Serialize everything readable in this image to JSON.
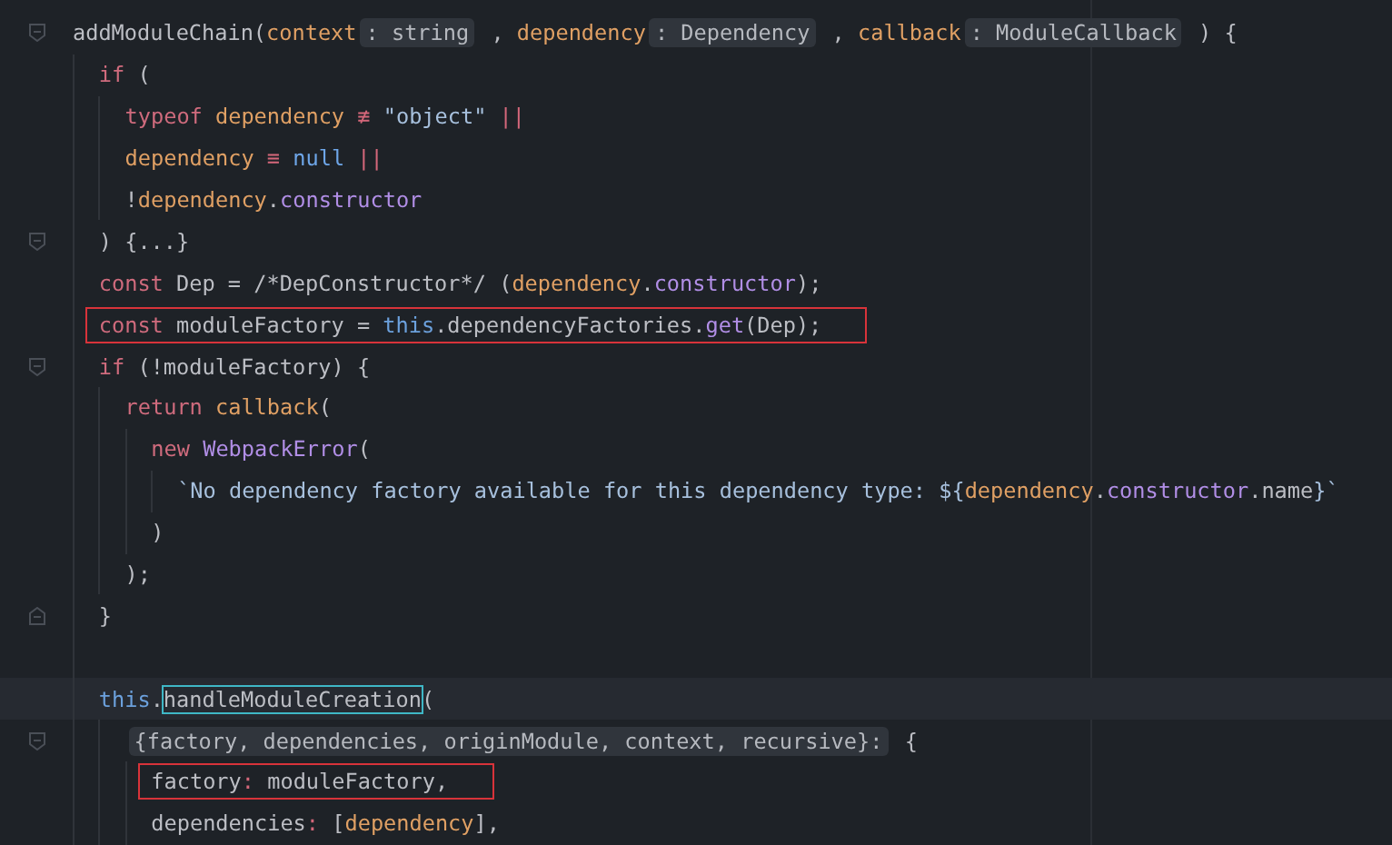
{
  "editor": {
    "lines": [
      {
        "kind": "code",
        "fold": {
          "kind": "start"
        },
        "tokens": [
          {
            "kind": "fn",
            "t": "addModuleChain("
          },
          {
            "kind": "param",
            "t": "context"
          },
          {
            "kind": "hint",
            "t": ": string"
          },
          {
            "kind": "plain",
            "t": " , "
          },
          {
            "kind": "param",
            "t": "dependency"
          },
          {
            "kind": "hint",
            "t": ": Dependency"
          },
          {
            "kind": "plain",
            "t": " , "
          },
          {
            "kind": "param",
            "t": "callback"
          },
          {
            "kind": "hint",
            "t": ": ModuleCallback"
          },
          {
            "kind": "plain",
            "t": " ) {"
          }
        ],
        "children": [
          {
            "kind": "code",
            "tokens": [
              {
                "kind": "kw",
                "t": "if"
              },
              {
                "kind": "plain",
                "t": " ("
              }
            ],
            "children": [
              {
                "kind": "code",
                "tokens": [
                  {
                    "kind": "kw",
                    "t": "typeof "
                  },
                  {
                    "kind": "param",
                    "t": "dependency "
                  },
                  {
                    "kind": "op",
                    "t": "≢ "
                  },
                  {
                    "kind": "str",
                    "t": "\"object\" "
                  },
                  {
                    "kind": "op",
                    "t": "||"
                  }
                ]
              },
              {
                "kind": "code",
                "tokens": [
                  {
                    "kind": "param",
                    "t": "dependency "
                  },
                  {
                    "kind": "op",
                    "t": "≡ "
                  },
                  {
                    "kind": "const",
                    "t": "null "
                  },
                  {
                    "kind": "op",
                    "t": "||"
                  }
                ]
              },
              {
                "kind": "code",
                "tokens": [
                  {
                    "kind": "plain",
                    "t": "!"
                  },
                  {
                    "kind": "param",
                    "t": "dependency"
                  },
                  {
                    "kind": "plain",
                    "t": "."
                  },
                  {
                    "kind": "prop",
                    "t": "constructor"
                  }
                ]
              }
            ]
          },
          {
            "kind": "code",
            "fold": {
              "kind": "start"
            },
            "tokens": [
              {
                "kind": "plain",
                "t": ") {...}"
              }
            ]
          },
          {
            "kind": "code",
            "tokens": [
              {
                "kind": "kw",
                "t": "const "
              },
              {
                "kind": "plain",
                "t": "Dep = /*DepConstructor*/ ("
              },
              {
                "kind": "param",
                "t": "dependency"
              },
              {
                "kind": "plain",
                "t": "."
              },
              {
                "kind": "prop",
                "t": "constructor"
              },
              {
                "kind": "plain",
                "t": ");"
              }
            ]
          },
          {
            "kind": "code",
            "boxed": true,
            "tokens": [
              {
                "kind": "kw",
                "t": "const "
              },
              {
                "kind": "plain",
                "t": "moduleFactory = "
              },
              {
                "kind": "this",
                "t": "this"
              },
              {
                "kind": "plain",
                "t": ".dependencyFactories."
              },
              {
                "kind": "prop",
                "t": "get"
              },
              {
                "kind": "plain",
                "t": "(Dep);"
              }
            ]
          },
          {
            "kind": "code",
            "fold": {
              "kind": "start"
            },
            "tokens": [
              {
                "kind": "kw",
                "t": "if"
              },
              {
                "kind": "plain",
                "t": " (!moduleFactory) {"
              }
            ],
            "children": [
              {
                "kind": "code",
                "tokens": [
                  {
                    "kind": "kw",
                    "t": "return "
                  },
                  {
                    "kind": "param",
                    "t": "callback"
                  },
                  {
                    "kind": "plain",
                    "t": "("
                  }
                ],
                "children": [
                  {
                    "kind": "code",
                    "tokens": [
                      {
                        "kind": "kw",
                        "t": "new "
                      },
                      {
                        "kind": "prop",
                        "t": "WebpackError"
                      },
                      {
                        "kind": "plain",
                        "t": "("
                      }
                    ],
                    "children": [
                      {
                        "kind": "code",
                        "tokens": [
                          {
                            "kind": "str",
                            "t": "`No dependency factory available for this dependency type: ${"
                          },
                          {
                            "kind": "param",
                            "t": "dependency"
                          },
                          {
                            "kind": "plain",
                            "t": "."
                          },
                          {
                            "kind": "prop",
                            "t": "constructor"
                          },
                          {
                            "kind": "plain",
                            "t": ".name"
                          },
                          {
                            "kind": "str",
                            "t": "}`"
                          }
                        ]
                      }
                    ]
                  },
                  {
                    "kind": "code",
                    "tokens": [
                      {
                        "kind": "plain",
                        "t": ")"
                      }
                    ]
                  }
                ]
              },
              {
                "kind": "code",
                "tokens": [
                  {
                    "kind": "plain",
                    "t": ");"
                  }
                ]
              }
            ]
          },
          {
            "kind": "code",
            "fold": {
              "kind": "end"
            },
            "tokens": [
              {
                "kind": "plain",
                "t": "}"
              }
            ]
          },
          {
            "kind": "blank"
          },
          {
            "kind": "code",
            "current": true,
            "tokens": [
              {
                "kind": "this",
                "t": "this"
              },
              {
                "kind": "plain",
                "t": "."
              },
              {
                "kind": "plain",
                "t": "handleModuleCreation",
                "outlined": true
              },
              {
                "kind": "plain",
                "t": "("
              }
            ],
            "children": [
              {
                "kind": "code",
                "fold": {
                  "kind": "start"
                },
                "tokens": [
                  {
                    "kind": "hint",
                    "t": "{factory, dependencies, originModule, context, recursive}:"
                  },
                  {
                    "kind": "plain",
                    "t": " {"
                  }
                ],
                "children": [
                  {
                    "kind": "code",
                    "boxed": true,
                    "tokens": [
                      {
                        "kind": "plain",
                        "t": "factory"
                      },
                      {
                        "kind": "op",
                        "t": ": "
                      },
                      {
                        "kind": "plain",
                        "t": "moduleFactory,"
                      }
                    ]
                  },
                  {
                    "kind": "code",
                    "tokens": [
                      {
                        "kind": "plain",
                        "t": "dependencies"
                      },
                      {
                        "kind": "op",
                        "t": ": "
                      },
                      {
                        "kind": "plain",
                        "t": "["
                      },
                      {
                        "kind": "param",
                        "t": "dependency"
                      },
                      {
                        "kind": "plain",
                        "t": "],"
                      }
                    ]
                  }
                ]
              }
            ]
          }
        ]
      }
    ]
  }
}
